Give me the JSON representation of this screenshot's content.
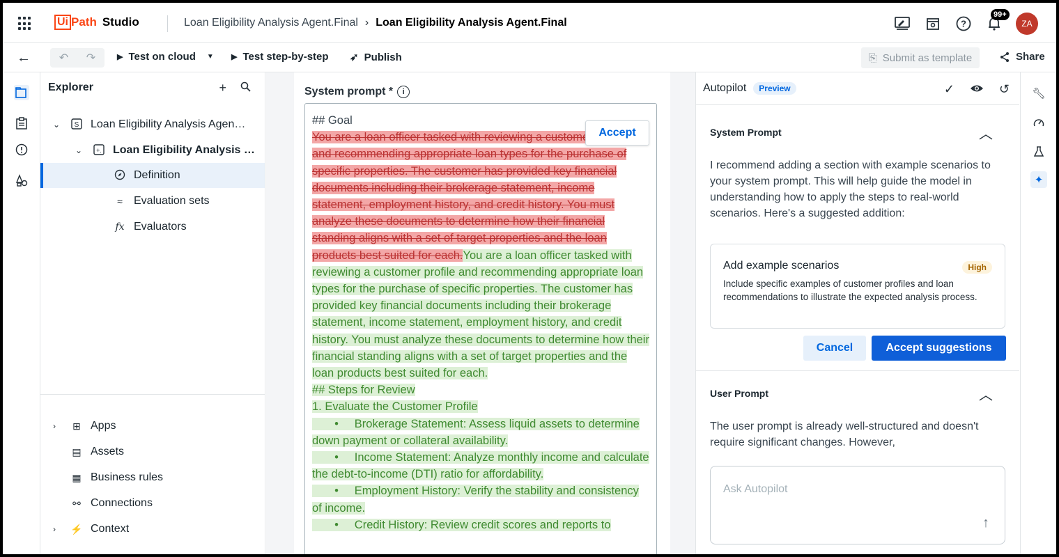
{
  "app": {
    "logo_box": "Ui",
    "logo_path": "Path",
    "product": "Studio",
    "breadcrumb": [
      "Loan Eligibility Analysis Agent.Final",
      "Loan Eligibility Analysis Agent.Final"
    ],
    "notifications_badge": "99+",
    "avatar_initials": "ZA"
  },
  "toolbar": {
    "test_on_cloud": "Test on cloud",
    "test_step_by_step": "Test step-by-step",
    "publish": "Publish",
    "submit_as_template": "Submit as template",
    "share": "Share"
  },
  "explorer": {
    "title": "Explorer",
    "tree": [
      {
        "label": "Loan Eligibility Analysis Agen…",
        "icon": "solution-icon"
      },
      {
        "label": "Loan Eligibility Analysis …",
        "icon": "agent-icon"
      },
      {
        "label": "Definition",
        "icon": "compass-icon"
      },
      {
        "label": "Evaluation sets",
        "icon": "evaluation-icon"
      },
      {
        "label": "Evaluators",
        "icon": "function-icon"
      }
    ],
    "resources": [
      {
        "label": "Apps",
        "icon": "apps-icon"
      },
      {
        "label": "Assets",
        "icon": "assets-icon"
      },
      {
        "label": "Business rules",
        "icon": "table-icon"
      },
      {
        "label": "Connections",
        "icon": "connections-icon"
      },
      {
        "label": "Context",
        "icon": "context-icon"
      }
    ]
  },
  "editor": {
    "label": "System prompt *",
    "accept_label": "Accept",
    "goal_heading": "## Goal",
    "deleted_text": "You are a loan officer tasked with reviewing a customer profile and recommending appropriate loan types for the purchase of specific properties. The customer has provided key financial documents including their brokerage statement, income statement, employment history, and credit history. You must analyze these documents to determine how their financial standing aligns with a set of target properties and the loan products best suited for each.",
    "added_text": "You are a loan officer tasked with reviewing a customer profile and recommending appropriate loan types for the purchase of specific properties. The customer has provided key financial documents including their brokerage statement, income statement, employment history, and credit history. You must analyze these documents to determine how their financial standing aligns with a set of target properties and the loan products best suited for each.",
    "steps_heading": "## Steps for Review",
    "step1": "1. Evaluate the Customer Profile",
    "bullets": [
      "Brokerage Statement: Assess liquid assets to determine down payment or collateral availability.",
      "Income Statement: Analyze monthly income and calculate the debt-to-income (DTI) ratio for affordability.",
      "Employment History: Verify the stability and consistency of income.",
      "Credit History: Review credit scores and reports to"
    ]
  },
  "autopilot": {
    "title": "Autopilot",
    "preview": "Preview",
    "system_prompt_heading": "System Prompt",
    "system_prompt_text": "I recommend adding a section with example scenarios to your system prompt. This will help guide the model in understanding how to apply the steps to real-world scenarios. Here's a suggested addition:",
    "suggestion_title": "Add example scenarios",
    "suggestion_priority": "High",
    "suggestion_desc": "Include specific examples of customer profiles and loan recommendations to illustrate the expected analysis process.",
    "cancel": "Cancel",
    "accept_suggestions": "Accept suggestions",
    "user_prompt_heading": "User Prompt",
    "user_prompt_text": "The user prompt is already well-structured and doesn't require significant changes. However,",
    "ask_placeholder": "Ask Autopilot"
  },
  "colors": {
    "accent": "#0067df",
    "brand": "#fa4616",
    "deleted_bg": "#f3a7a7",
    "added_bg": "#ddf0d6"
  }
}
